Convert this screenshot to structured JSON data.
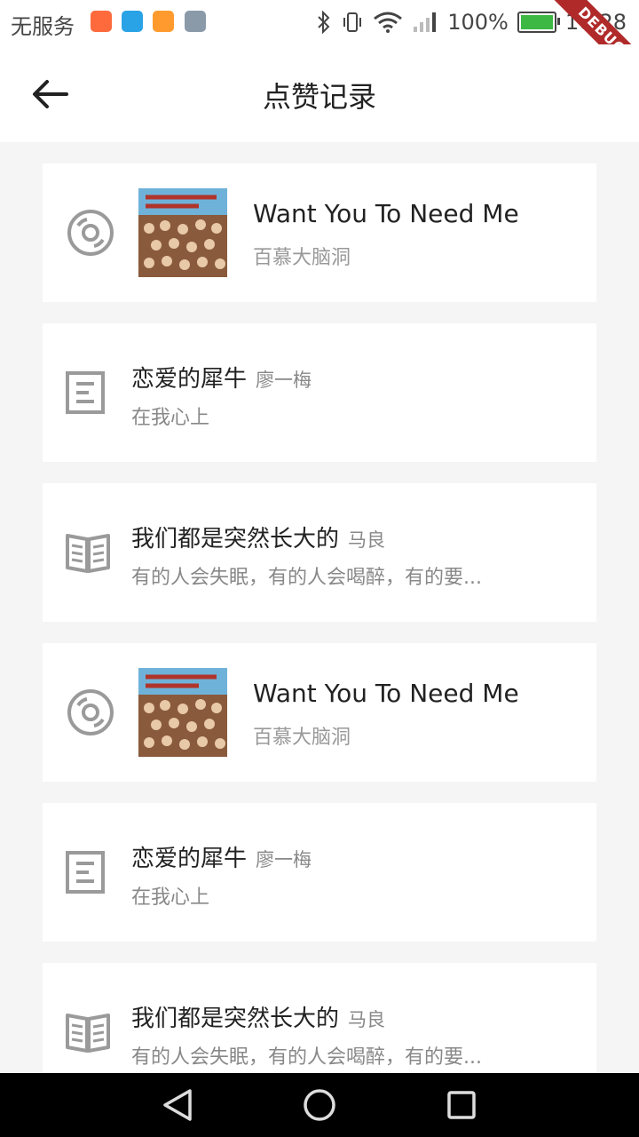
{
  "status_bar": {
    "carrier": "无服务",
    "battery_percent": "100%",
    "time": "16:28",
    "debug_label": "DEBUG",
    "notification_colors": [
      "#ff6a3d",
      "#2aa3e6",
      "#ff9b2e",
      "#8a9aa8"
    ]
  },
  "app_bar": {
    "title": "点赞记录",
    "back_icon": "arrow-left-icon"
  },
  "items": [
    {
      "kind": "music",
      "icon": "disc-icon",
      "title": "Want You To Need Me",
      "subtitle": "百慕大脑洞"
    },
    {
      "kind": "article",
      "icon": "document-icon",
      "title": "恋爱的犀牛",
      "author": "廖一梅",
      "subtitle": "在我心上"
    },
    {
      "kind": "book",
      "icon": "book-icon",
      "title": "我们都是突然长大的",
      "author": "马良",
      "subtitle": "有的人会失眠，有的人会喝醉，有的要..."
    },
    {
      "kind": "music",
      "icon": "disc-icon",
      "title": "Want You To Need Me",
      "subtitle": "百慕大脑洞"
    },
    {
      "kind": "article",
      "icon": "document-icon",
      "title": "恋爱的犀牛",
      "author": "廖一梅",
      "subtitle": "在我心上"
    },
    {
      "kind": "book",
      "icon": "book-icon",
      "title": "我们都是突然长大的",
      "author": "马良",
      "subtitle": "有的人会失眠，有的人会喝醉，有的要..."
    }
  ],
  "nav_bar": {
    "back": "triangle-back-icon",
    "home": "circle-home-icon",
    "recents": "square-recents-icon"
  }
}
